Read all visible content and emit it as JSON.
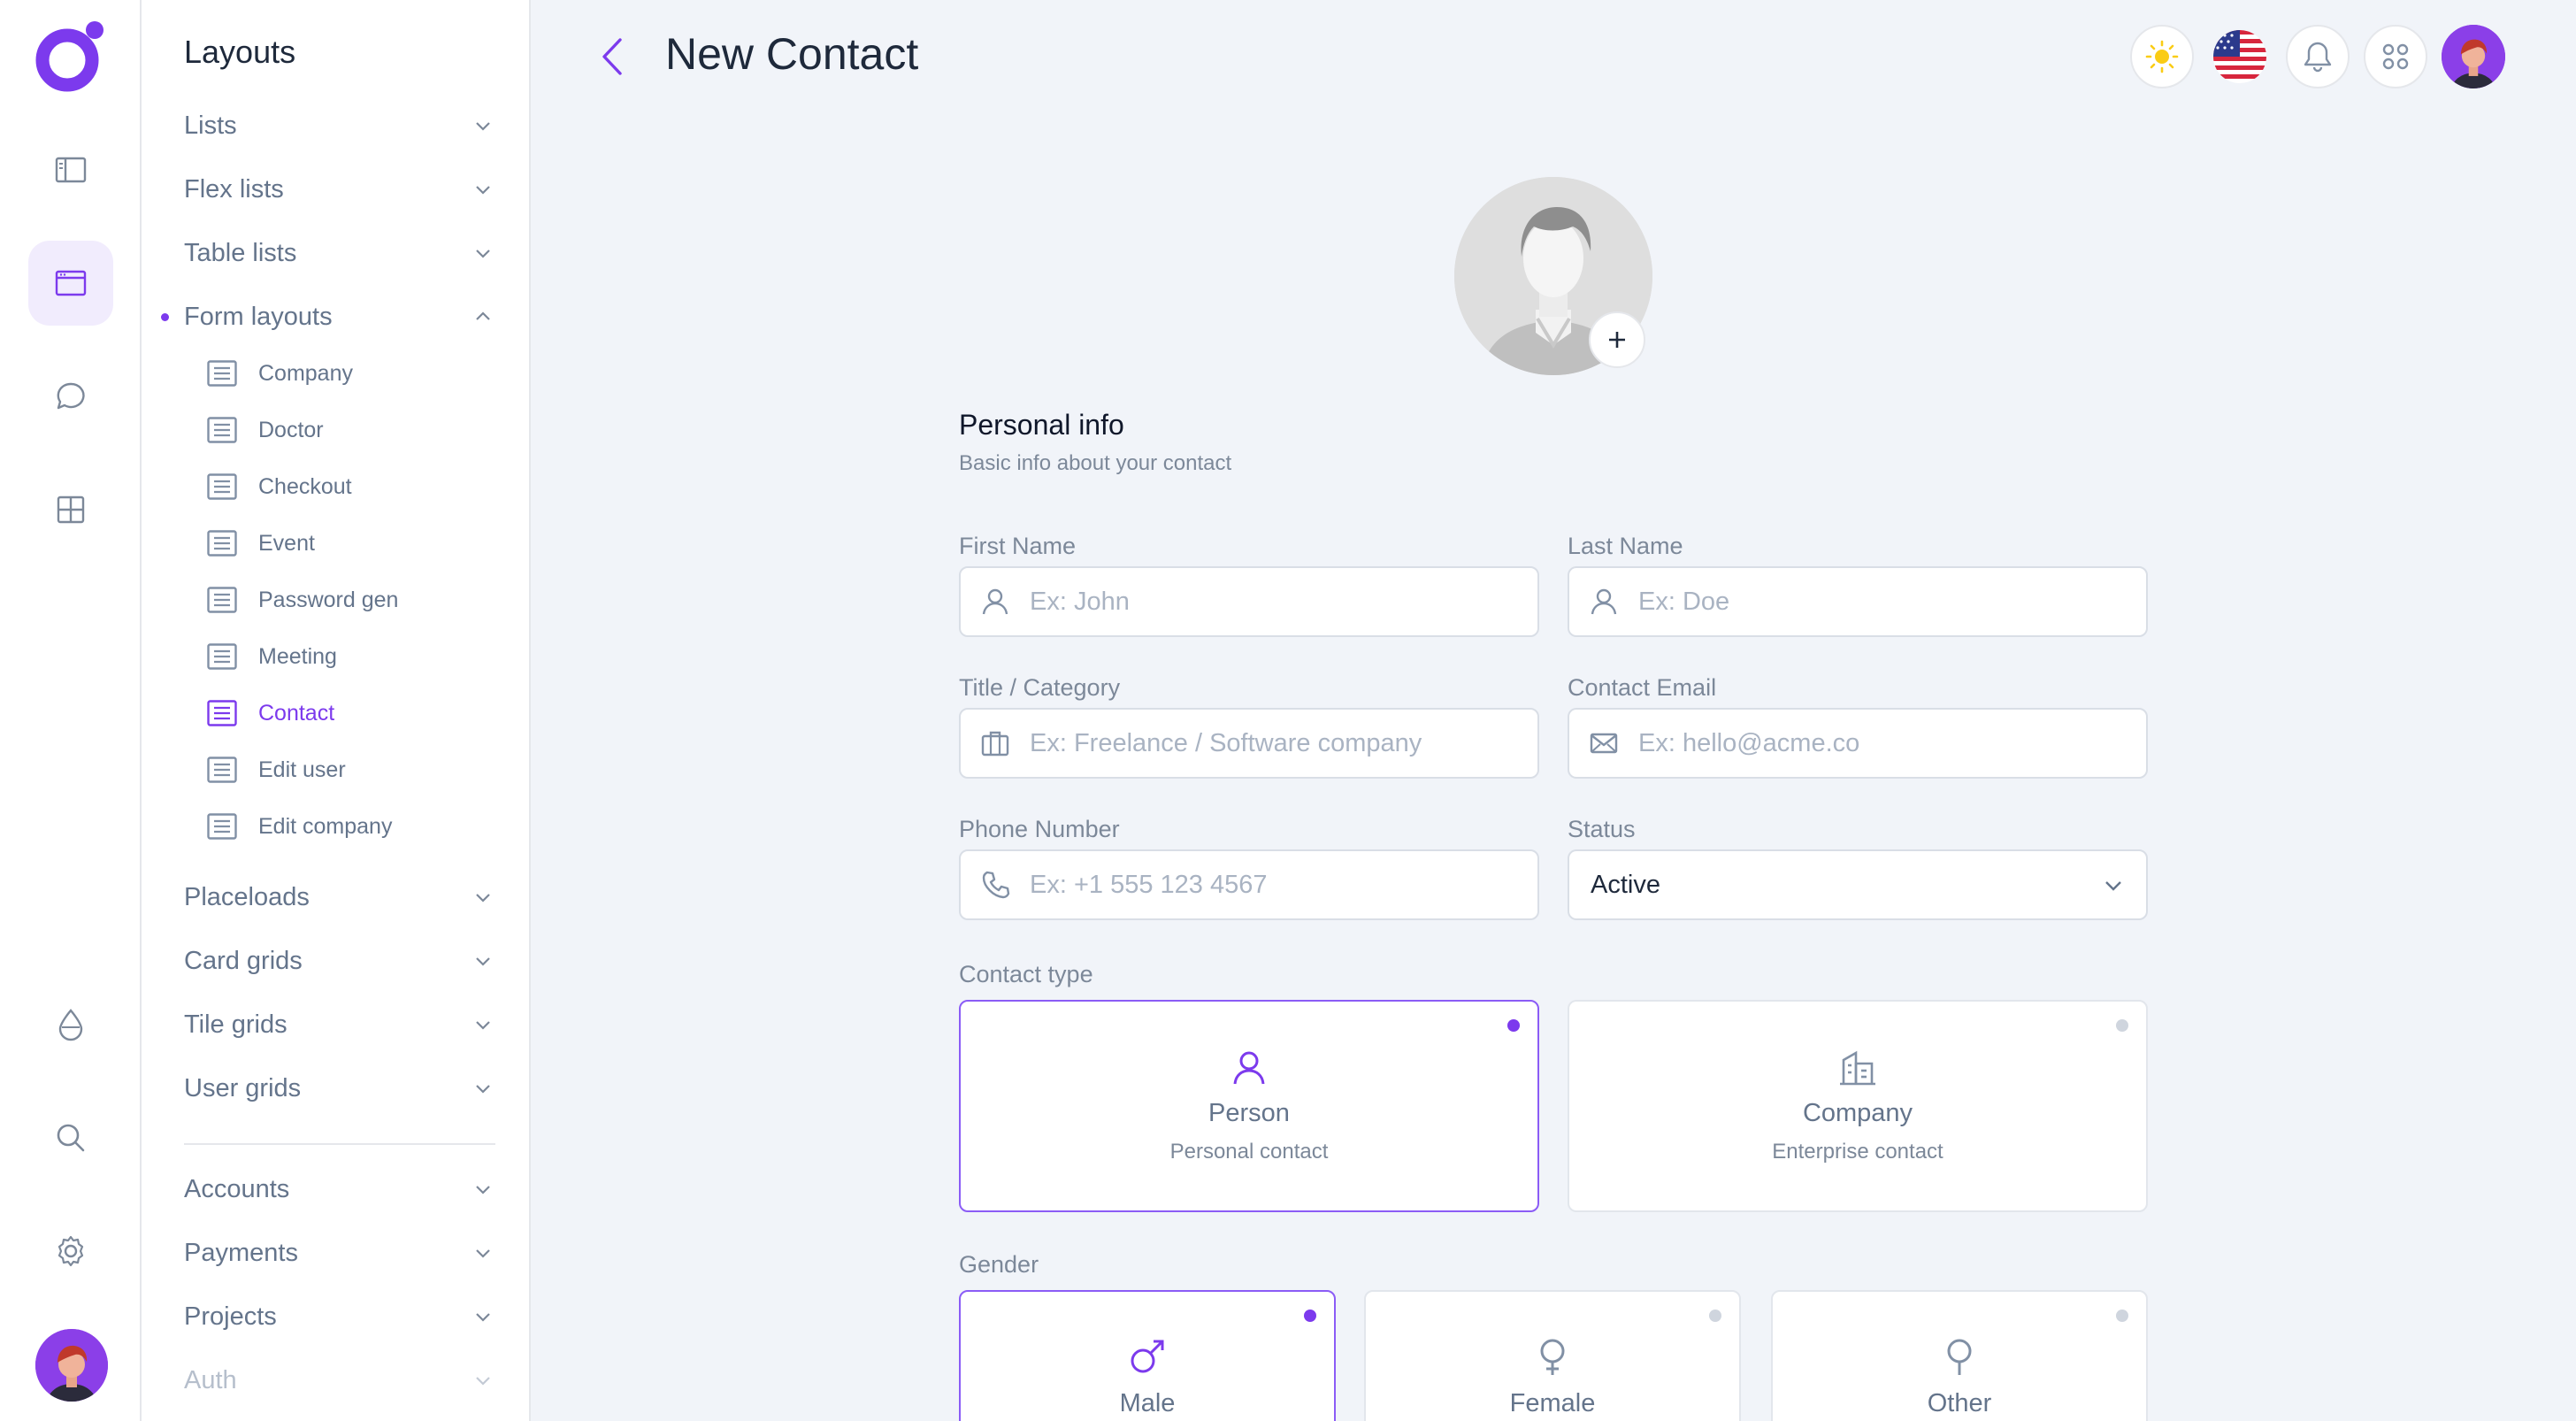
{
  "sidebar": {
    "title": "Layouts",
    "groups_top": [
      {
        "label": "Lists"
      },
      {
        "label": "Flex lists"
      },
      {
        "label": "Table lists"
      },
      {
        "label": "Form layouts"
      }
    ],
    "form_items": [
      {
        "label": "Company"
      },
      {
        "label": "Doctor"
      },
      {
        "label": "Checkout"
      },
      {
        "label": "Event"
      },
      {
        "label": "Password gen"
      },
      {
        "label": "Meeting"
      },
      {
        "label": "Contact"
      },
      {
        "label": "Edit user"
      },
      {
        "label": "Edit company"
      }
    ],
    "groups_mid": [
      {
        "label": "Placeloads"
      },
      {
        "label": "Card grids"
      },
      {
        "label": "Tile grids"
      },
      {
        "label": "User grids"
      }
    ],
    "groups_bottom": [
      {
        "label": "Accounts"
      },
      {
        "label": "Payments"
      },
      {
        "label": "Projects"
      },
      {
        "label": "Auth"
      }
    ]
  },
  "header": {
    "title": "New Contact"
  },
  "form": {
    "section_title": "Personal info",
    "section_subtitle": "Basic info about your contact",
    "first_name": {
      "label": "First Name",
      "placeholder": "Ex: John",
      "value": ""
    },
    "last_name": {
      "label": "Last Name",
      "placeholder": "Ex: Doe",
      "value": ""
    },
    "title_category": {
      "label": "Title / Category",
      "placeholder": "Ex: Freelance / Software company",
      "value": ""
    },
    "email": {
      "label": "Contact Email",
      "placeholder": "Ex: hello@acme.co",
      "value": ""
    },
    "phone": {
      "label": "Phone Number",
      "placeholder": "Ex: +1 555 123 4567",
      "value": ""
    },
    "status": {
      "label": "Status",
      "value": "Active"
    },
    "contact_type": {
      "label": "Contact type",
      "options": [
        {
          "title": "Person",
          "subtitle": "Personal contact",
          "selected": true
        },
        {
          "title": "Company",
          "subtitle": "Enterprise contact",
          "selected": false
        }
      ]
    },
    "gender": {
      "label": "Gender",
      "options": [
        {
          "title": "Male",
          "selected": true
        },
        {
          "title": "Female",
          "selected": false
        },
        {
          "title": "Other",
          "selected": false
        }
      ]
    }
  },
  "colors": {
    "accent": "#7c3aed",
    "background": "#f1f4f9",
    "surface": "#ffffff",
    "muted_text": "#64748b"
  }
}
